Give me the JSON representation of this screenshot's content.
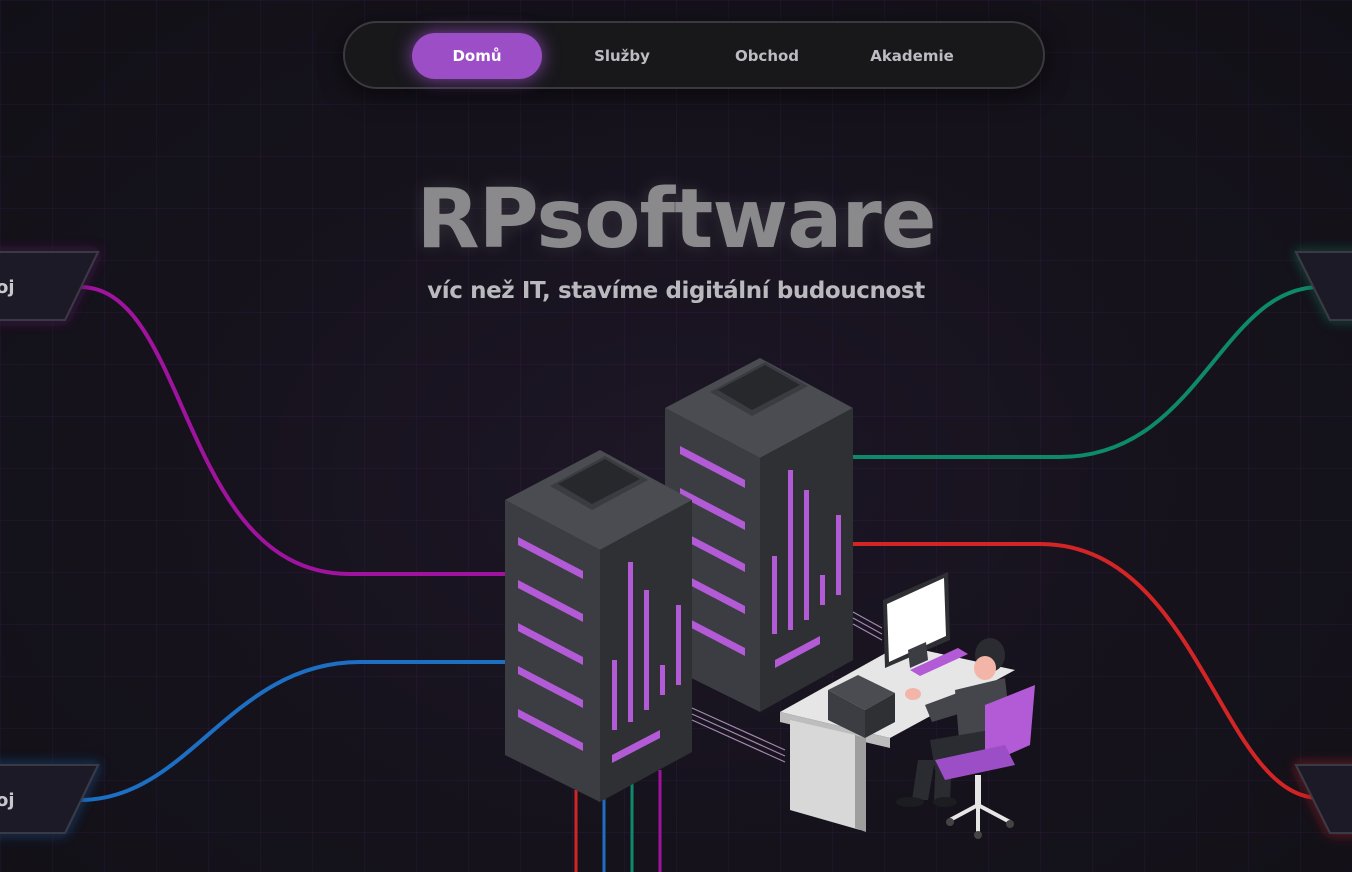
{
  "nav": {
    "items": [
      {
        "label": "Domů",
        "active": true
      },
      {
        "label": "Služby",
        "active": false
      },
      {
        "label": "Obchod",
        "active": false
      },
      {
        "label": "Akademie",
        "active": false
      }
    ]
  },
  "hero": {
    "title": "RPsoftware",
    "subtitle": "víc než IT, stavíme digitální budoucnost"
  },
  "side_tags": {
    "top_left": "oj",
    "bottom_left": "oj"
  },
  "colors": {
    "background": "#14111c",
    "accent": "#9b4ec5",
    "line_magenta": "#a0139e",
    "line_blue": "#1d6fc4",
    "line_teal": "#0d8a6a",
    "line_red": "#d32525"
  }
}
